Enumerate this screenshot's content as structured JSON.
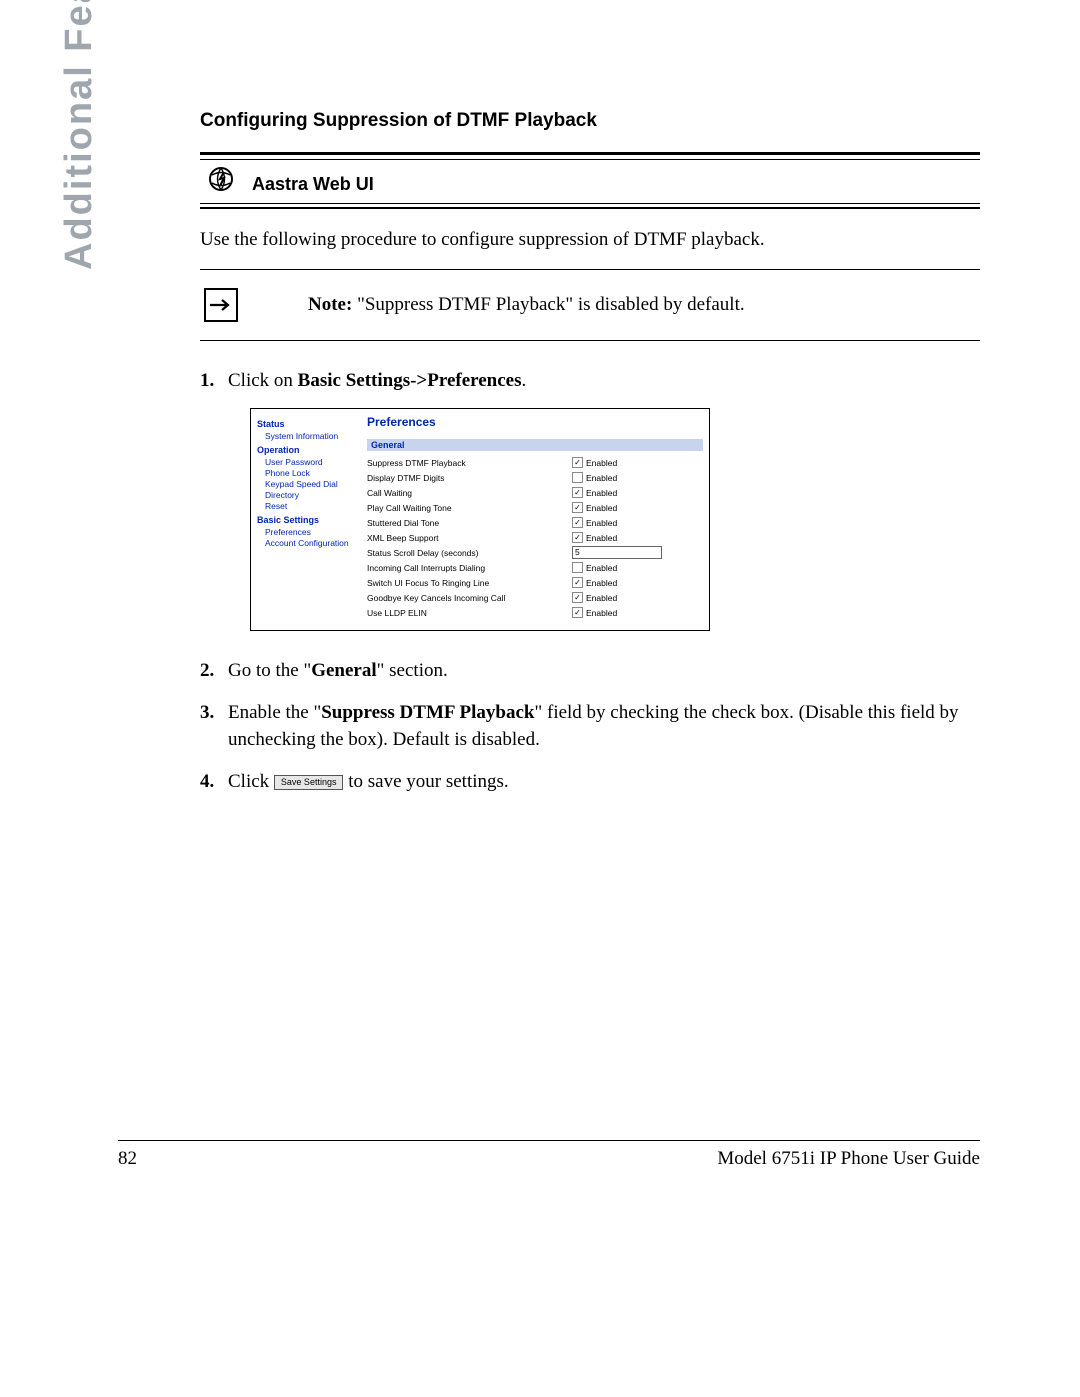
{
  "sideTab": "Additional Features",
  "sectionTitle": "Configuring Suppression of DTMF Playback",
  "webUiLabel": "Aastra Web UI",
  "intro": "Use the following procedure to configure suppression of DTMF playback.",
  "note": {
    "label": "Note:",
    "text": " \"Suppress DTMF Playback\" is disabled by default."
  },
  "steps": {
    "s1_pre": "Click on ",
    "s1_bold": "Basic Settings->Preferences",
    "s1_post": ".",
    "s2_pre": "Go to the \"",
    "s2_bold": "General",
    "s2_post": "\" section.",
    "s3_pre": "Enable the \"",
    "s3_bold": "Suppress DTMF Playback",
    "s3_post": "\" field by checking the check box. (Disable this field by unchecking the box). Default is disabled.",
    "s4_pre": "Click ",
    "s4_btn": "Save Settings",
    "s4_post": " to save your settings."
  },
  "screenshot": {
    "nav": {
      "status": "Status",
      "statusItems": [
        "System Information"
      ],
      "operation": "Operation",
      "operationItems": [
        "User Password",
        "Phone Lock",
        "Keypad Speed Dial",
        "Directory",
        "Reset"
      ],
      "basic": "Basic Settings",
      "basicItems": [
        "Preferences",
        "Account Configuration"
      ]
    },
    "title": "Preferences",
    "sectionBar": "General",
    "enabledLabel": "Enabled",
    "rows": [
      {
        "label": "Suppress DTMF Playback",
        "type": "check",
        "checked": true
      },
      {
        "label": "Display DTMF Digits",
        "type": "check",
        "checked": false
      },
      {
        "label": "Call Waiting",
        "type": "check",
        "checked": true
      },
      {
        "label": "Play Call Waiting Tone",
        "type": "check",
        "checked": true
      },
      {
        "label": "Stuttered Dial Tone",
        "type": "check",
        "checked": true
      },
      {
        "label": "XML Beep Support",
        "type": "check",
        "checked": true
      },
      {
        "label": "Status Scroll Delay (seconds)",
        "type": "input",
        "value": "5"
      },
      {
        "label": "Incoming Call Interrupts Dialing",
        "type": "check",
        "checked": false
      },
      {
        "label": "Switch UI Focus To Ringing Line",
        "type": "check",
        "checked": true
      },
      {
        "label": "Goodbye Key Cancels Incoming Call",
        "type": "check",
        "checked": true
      },
      {
        "label": "Use LLDP ELIN",
        "type": "check",
        "checked": true
      }
    ]
  },
  "footer": {
    "page": "82",
    "guide": "Model 6751i IP Phone User Guide"
  }
}
